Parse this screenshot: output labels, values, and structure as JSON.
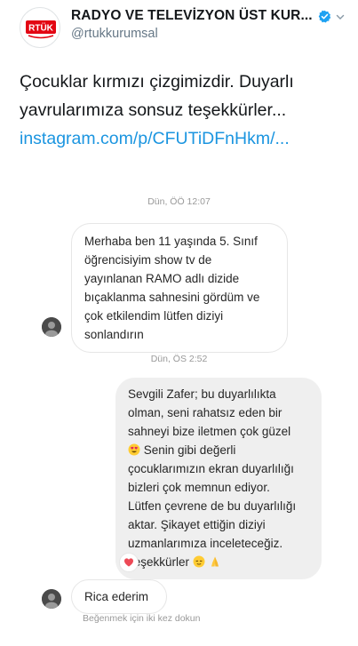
{
  "account": {
    "logo_text": "RTÜK",
    "display_name": "RADYO VE TELEVİZYON ÜST KUR...",
    "handle": "@rtukkurumsal",
    "verified": true,
    "avatar_icon": "rtuk-logo-icon",
    "verified_icon": "verified-badge-icon",
    "menu_icon": "chevron-down-icon"
  },
  "tweet": {
    "lines": [
      "Çocuklar kırmızı çizgimizdir. Duyarlı",
      "yavrularımıza sonsuz teşekkürler..."
    ],
    "link": "instagram.com/p/CFUTiDFnHkm/..."
  },
  "chat": {
    "timestamp_1": "Dün, ÖÖ 12:07",
    "message_1": [
      "Merhaba ben 11 yaşında 5. Sınıf",
      "öğrencisiyim show tv de",
      "yayınlanan RAMO adlı dizide",
      "bıçaklanma sahnesini gördüm ve",
      "çok etkilendim lütfen diziyi",
      "sonlandırın"
    ],
    "timestamp_2": "Dün, ÖS 2:52",
    "message_2": [
      "Sevgili Zafer; bu duyarlılıkta",
      "olman, seni rahatsız eden bir",
      "sahneyi bize iletmen çok güzel",
      "Senin gibi değerli",
      "çocuklarımızın ekran duyarlılığı",
      "bizleri çok memnun ediyor.",
      "Lütfen çevrene de bu duyarlılığı",
      "aktar. Şikayet ettiğin diziyi",
      "uzmanlarımıza inceleteceğiz.",
      "Teşekkürler"
    ],
    "message_2_emojis": [
      "heart-eyes-emoji",
      "relieved-emoji",
      "folded-hands-emoji"
    ],
    "reaction_icon": "heart-icon",
    "message_3": "Rica ederim",
    "hint": "Beğenmek için iki kez dokun",
    "colors": {
      "link": "#1b95e0",
      "verified": "#1da1f2",
      "incoming_bubble_border": "#e6e6e6",
      "outgoing_bubble": "#efefef",
      "reaction": "#ed4956",
      "logo_red": "#e30613"
    }
  }
}
